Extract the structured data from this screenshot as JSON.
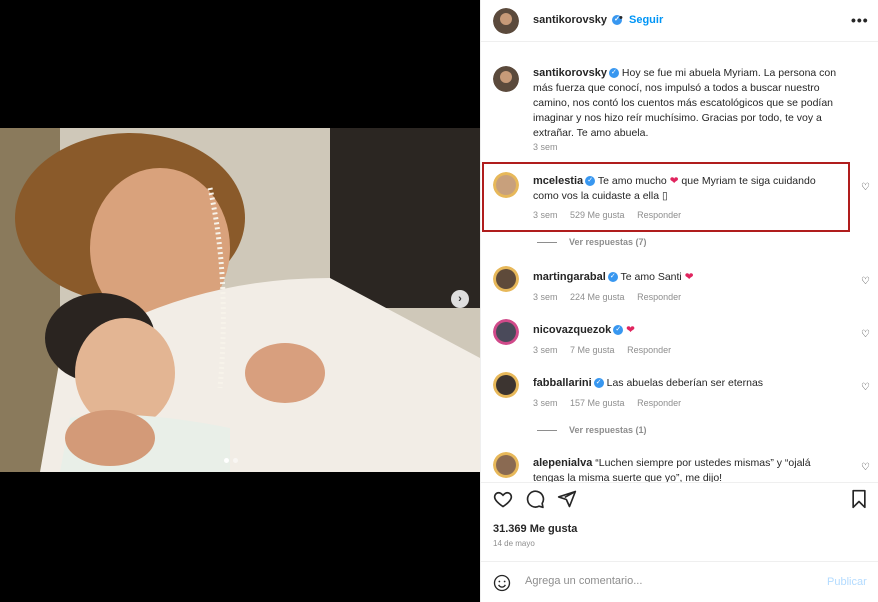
{
  "post": {
    "author": "santikorovsky",
    "follow_label": "Seguir",
    "dot": "•",
    "more_label": "•••",
    "caption": "Hoy se fue mi abuela Myriam. La persona con más fuerza que conocí, nos impulsó a todos a buscar nuestro camino, nos contó los cuentos más escatológicos que se podían imaginar y nos hizo reír muchísimo. Gracias por todo, te voy a extrañar. Te amo abuela.",
    "caption_time": "3 sem",
    "likes": "31.369 Me gusta",
    "date": "14 de mayo"
  },
  "comments": [
    {
      "user": "mcelestia",
      "text_a": "Te amo mucho ",
      "heart": "❤",
      "text_b": " que Myriam te siga cuidando como vos la cuidaste a ella ",
      "box": "▯",
      "time": "3 sem",
      "likes": "529 Me gusta",
      "reply": "Responder",
      "view_replies": "Ver respuestas (7)"
    },
    {
      "user": "martingarabal",
      "text_a": "Te amo Santi ",
      "heart": "❤",
      "time": "3 sem",
      "likes": "224 Me gusta",
      "reply": "Responder"
    },
    {
      "user": "nicovazquezok",
      "heart": "❤",
      "time": "3 sem",
      "likes": "7 Me gusta",
      "reply": "Responder"
    },
    {
      "user": "fabballarini",
      "text_a": "Las abuelas deberían ser eternas",
      "time": "3 sem",
      "likes": "157 Me gusta",
      "reply": "Responder",
      "view_replies": "Ver respuestas (1)"
    },
    {
      "user": "alepenialva",
      "text_a": "“Luchen siempre por ustedes mismas” y “ojalá tengas la misma suerte que yo”, me dijo!"
    }
  ],
  "composer": {
    "placeholder": "Agrega un comentario...",
    "publish": "Publicar"
  },
  "colors": {
    "accent": "#0095f6",
    "highlight_border": "#b01d1d",
    "heart": "#e0245e"
  },
  "icons": [
    "heart-icon",
    "comment-icon",
    "share-icon",
    "bookmark-icon",
    "emoji-icon",
    "verified-icon",
    "more-icon",
    "chevron-right-icon"
  ]
}
